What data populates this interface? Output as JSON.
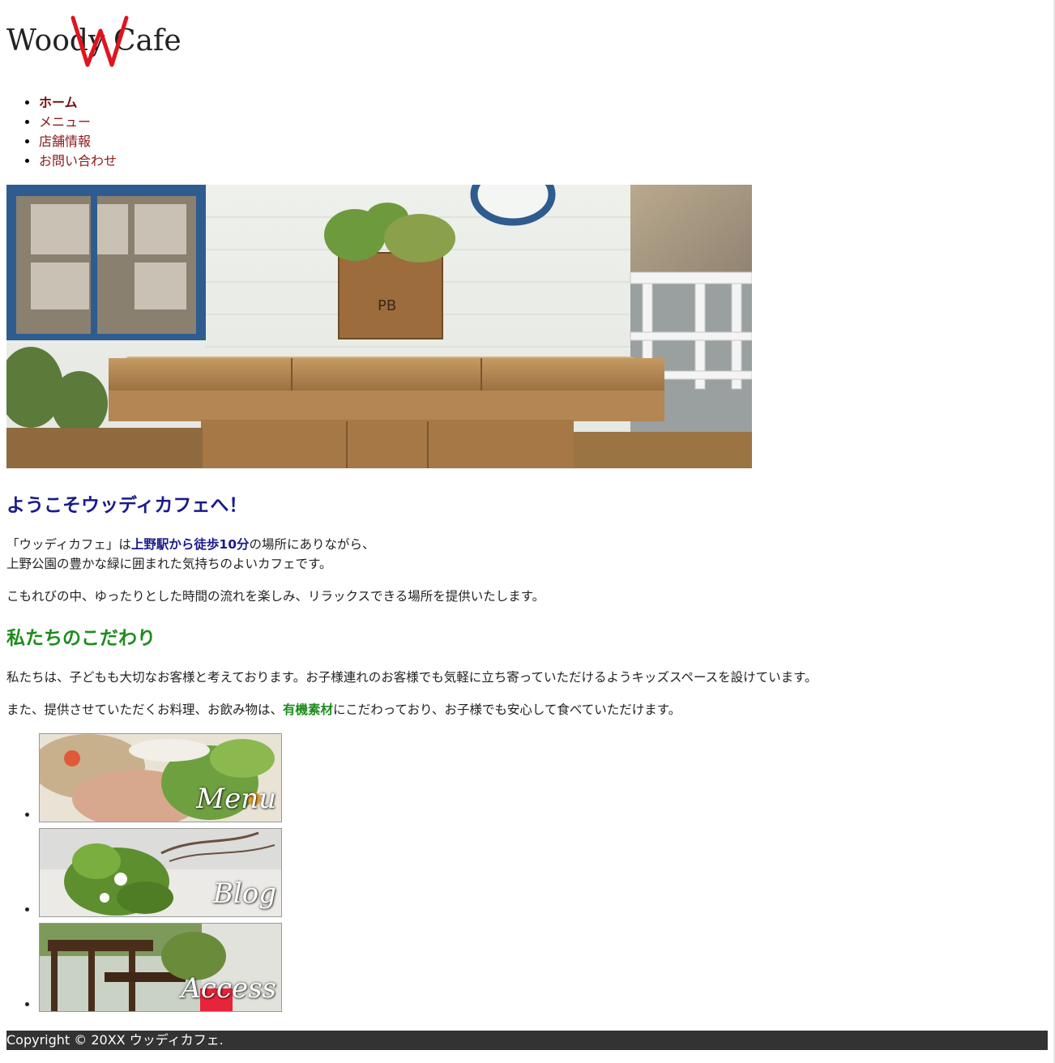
{
  "logo": {
    "text_left": "Woody",
    "text_right": "Cafe",
    "emblem_letter": "W",
    "emblem_color": "#e0141e"
  },
  "nav": {
    "items": [
      {
        "label": "ホーム",
        "active": true
      },
      {
        "label": "メニュー",
        "active": false
      },
      {
        "label": "店舗情報",
        "active": false
      },
      {
        "label": "お問い合わせ",
        "active": false
      }
    ]
  },
  "main": {
    "welcome_heading": "ようこそウッディカフェへ！",
    "intro": {
      "before": "「ウッディカフェ」は",
      "strong": "上野駅から徒歩10分",
      "after": "の場所にありながら、",
      "line2": "上野公園の豊かな緑に囲まれた気持ちのよいカフェです。"
    },
    "intro2": "こもれびの中、ゆったりとした時間の流れを楽しみ、リラックスできる場所を提供いたします。",
    "kodawari_heading": "私たちのこだわり",
    "kodawari_p1": "私たちは、子どもも大切なお客様と考えております。お子様連れのお客様でも気軽に立ち寄っていただけるようキッズスペースを設けています。",
    "kodawari_p2": {
      "before": "また、提供させていただくお料理、お飲み物は、",
      "strong": "有機素材",
      "after": "にこだわっており、お子様でも安心して食べていただけます。"
    }
  },
  "banners": [
    {
      "label": "Menu"
    },
    {
      "label": "Blog"
    },
    {
      "label": "Access"
    }
  ],
  "footer": {
    "copyright": "Copyright © 20XX ウッディカフェ."
  },
  "colors": {
    "welcome_heading": "#1a1a8c",
    "kodawari_heading": "#1e8c1e",
    "nav_link": "#8b1a1a",
    "footer_bg": "#333333"
  }
}
